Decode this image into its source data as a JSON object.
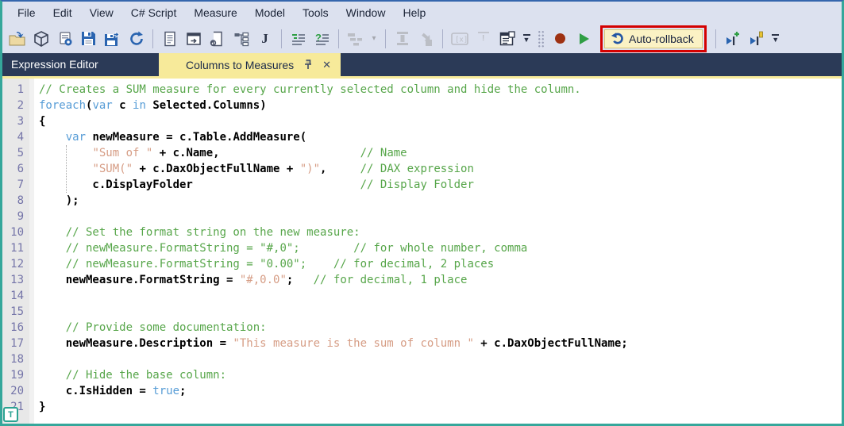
{
  "menu": {
    "items": [
      "File",
      "Edit",
      "View",
      "C# Script",
      "Measure",
      "Model",
      "Tools",
      "Window",
      "Help"
    ]
  },
  "toolbar": {
    "auto_rollback_label": "Auto-rollback",
    "icon_names": [
      "open-file",
      "open-model",
      "save-to-database",
      "save",
      "save-as",
      "refresh",
      "new-script",
      "open-script-window",
      "run-script-file",
      "model-hierarchy",
      "script",
      "format-dax",
      "syntax-check",
      "diagram",
      "diagram-dropdown",
      "insert-column",
      "move-object",
      "console",
      "best-practice-analyzer",
      "properties-window",
      "toolbar-overflow",
      "record-macro",
      "run-script",
      "auto-rollback",
      "run-script-new",
      "run-script-edit",
      "toolbar-overflow"
    ]
  },
  "tabs": {
    "panel_title": "Expression Editor",
    "active_tab": "Columns to Measures"
  },
  "colors": {
    "window_border_teal": "#35a79b",
    "top_border_blue": "#3566ad",
    "toolbar_bg": "#dce1ef",
    "tabstrip_bg": "#2b3a57",
    "active_tab_yellow": "#f7ea9a",
    "annotation_red": "#d40000",
    "auto_rollback_bg": "#fbf2c4",
    "comment_green": "#57a64a",
    "keyword_blue": "#569cd6",
    "string_salmon": "#d69d85",
    "line_number_purple": "#7474a8",
    "record_red": "#9e3112",
    "play_green": "#2f9e44"
  },
  "editor": {
    "badge": "T",
    "lines": [
      {
        "num": 1,
        "seg": [
          {
            "t": "// Creates a SUM measure for every currently selected column and hide the column.",
            "c": "c"
          }
        ]
      },
      {
        "num": 2,
        "seg": [
          {
            "t": "foreach",
            "c": "k"
          },
          {
            "t": "(",
            "c": "p"
          },
          {
            "t": "var",
            "c": "k"
          },
          {
            "t": " c ",
            "c": "p"
          },
          {
            "t": "in",
            "c": "k"
          },
          {
            "t": " Selected.Columns)",
            "c": "p"
          }
        ]
      },
      {
        "num": 3,
        "seg": [
          {
            "t": "{",
            "c": "p"
          }
        ]
      },
      {
        "num": 4,
        "seg": [
          {
            "t": "    ",
            "c": "p"
          },
          {
            "t": "var",
            "c": "k"
          },
          {
            "t": " newMeasure = c.Table.AddMeasure(",
            "c": "p"
          }
        ]
      },
      {
        "num": 5,
        "seg": [
          {
            "t": "        ",
            "c": "p"
          },
          {
            "t": "\"Sum of \"",
            "c": "s"
          },
          {
            "t": " + c.Name,",
            "c": "p"
          },
          {
            "t": "                     ",
            "c": "p"
          },
          {
            "t": "// Name",
            "c": "c"
          }
        ]
      },
      {
        "num": 6,
        "seg": [
          {
            "t": "        ",
            "c": "p"
          },
          {
            "t": "\"SUM(\"",
            "c": "s"
          },
          {
            "t": " + c.DaxObjectFullName + ",
            "c": "p"
          },
          {
            "t": "\")\"",
            "c": "s"
          },
          {
            "t": ",     ",
            "c": "p"
          },
          {
            "t": "// DAX expression",
            "c": "c"
          }
        ]
      },
      {
        "num": 7,
        "seg": [
          {
            "t": "        c.DisplayFolder",
            "c": "p"
          },
          {
            "t": "                         ",
            "c": "p"
          },
          {
            "t": "// Display Folder",
            "c": "c"
          }
        ]
      },
      {
        "num": 8,
        "seg": [
          {
            "t": "    );",
            "c": "p"
          }
        ]
      },
      {
        "num": 9,
        "seg": []
      },
      {
        "num": 10,
        "seg": [
          {
            "t": "    ",
            "c": "p"
          },
          {
            "t": "// Set the format string on the new measure:",
            "c": "c"
          }
        ]
      },
      {
        "num": 11,
        "seg": [
          {
            "t": "    ",
            "c": "p"
          },
          {
            "t": "// newMeasure.FormatString = \"#,0\";        // for whole number, comma",
            "c": "c"
          }
        ]
      },
      {
        "num": 12,
        "seg": [
          {
            "t": "    ",
            "c": "p"
          },
          {
            "t": "// newMeasure.FormatString = \"0.00\";    // for decimal, 2 places",
            "c": "c"
          }
        ]
      },
      {
        "num": 13,
        "seg": [
          {
            "t": "    newMeasure.FormatString = ",
            "c": "p"
          },
          {
            "t": "\"#,0.0\"",
            "c": "s"
          },
          {
            "t": ";   ",
            "c": "p"
          },
          {
            "t": "// for decimal, 1 place",
            "c": "c"
          }
        ]
      },
      {
        "num": 14,
        "seg": []
      },
      {
        "num": 15,
        "seg": []
      },
      {
        "num": 16,
        "seg": [
          {
            "t": "    ",
            "c": "p"
          },
          {
            "t": "// Provide some documentation:",
            "c": "c"
          }
        ]
      },
      {
        "num": 17,
        "seg": [
          {
            "t": "    newMeasure.Description = ",
            "c": "p"
          },
          {
            "t": "\"This measure is the sum of column \"",
            "c": "s"
          },
          {
            "t": " + c.DaxObjectFullName;",
            "c": "p"
          }
        ]
      },
      {
        "num": 18,
        "seg": []
      },
      {
        "num": 19,
        "seg": [
          {
            "t": "    ",
            "c": "p"
          },
          {
            "t": "// Hide the base column:",
            "c": "c"
          }
        ]
      },
      {
        "num": 20,
        "seg": [
          {
            "t": "    c.IsHidden = ",
            "c": "p"
          },
          {
            "t": "true",
            "c": "k"
          },
          {
            "t": ";",
            "c": "p"
          }
        ]
      },
      {
        "num": 21,
        "seg": [
          {
            "t": "}",
            "c": "p"
          }
        ]
      }
    ]
  }
}
